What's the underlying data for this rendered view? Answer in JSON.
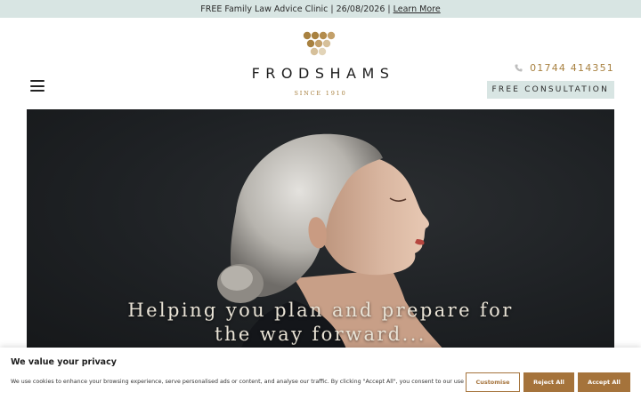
{
  "announcement": {
    "text": "FREE Family Law Advice Clinic | 26/08/2026 |",
    "link": "Learn More"
  },
  "header": {
    "menu_icon": "hamburger-menu-icon",
    "logo": {
      "wordmark": "FRODSHAMS",
      "tagline": "SINCE 1910",
      "dot_colors": [
        "#c3a06a",
        "#a88140",
        "#d6c09a"
      ]
    },
    "phone": {
      "icon": "phone-icon",
      "number": "01744 414351"
    },
    "cta_label": "FREE CONSULTATION"
  },
  "hero": {
    "line1": "Helping you plan and prepare for",
    "line2": "the way forward..."
  },
  "cookie_banner": {
    "title": "We value your privacy",
    "text": "We use cookies to enhance your browsing experience, serve personalised ads or content, and analyse our traffic. By clicking \"Accept All\", you consent to our use of cookies.",
    "customise_label": "Customise",
    "reject_label": "Reject All",
    "accept_label": "Accept All"
  },
  "colors": {
    "accent": "#a88140",
    "button_brown": "#a5733b",
    "announce_bg": "#d8e5e3",
    "hero_bg": "#1e2124"
  }
}
